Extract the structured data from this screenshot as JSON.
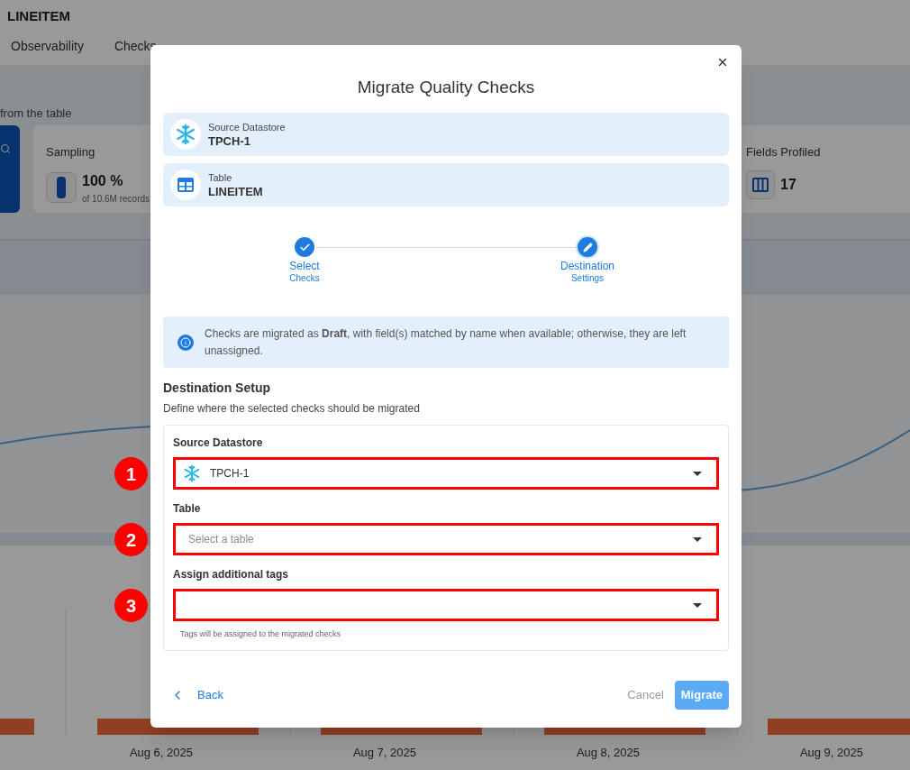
{
  "page": {
    "title": "LINEITEM",
    "tabs": [
      {
        "label": "Observability",
        "selected": false
      },
      {
        "label": "Checks",
        "selected": false
      }
    ],
    "subtitle": "from the table",
    "stats": [
      {
        "label": "Sampling",
        "value": "100 %",
        "note": "of 10.6M records",
        "kind": "sampling"
      },
      {
        "label": "Fields Profiled",
        "value": "17",
        "kind": "fields"
      }
    ],
    "chart_dates": [
      "Aug 6, 2025",
      "Aug 7, 2025",
      "Aug 8, 2025",
      "Aug 9, 2025"
    ]
  },
  "dialog": {
    "title": "Migrate Quality Checks",
    "summary": [
      {
        "label": "Source Datastore",
        "value": "TPCH-1",
        "kind": "datastore"
      },
      {
        "label": "Table",
        "value": "LINEITEM",
        "kind": "table"
      }
    ],
    "steps": [
      {
        "title": "Select",
        "subtitle": "Checks",
        "completed": true
      },
      {
        "title": "Destination",
        "subtitle": "Settings",
        "completed": false
      }
    ],
    "notice": "Checks are migrated as **Draft**, with field(s) matched by name when available; otherwise, they are left unassigned.",
    "section_title": "Destination Setup",
    "section_description": "Define where the selected checks should be migrated",
    "fields": [
      {
        "label": "Source Datastore",
        "value": "TPCH-1",
        "kind": "datastore",
        "highlighted": true,
        "marker": "1"
      },
      {
        "label": "Table",
        "placeholder": "Select a table",
        "kind": "plain",
        "highlighted": true,
        "marker": "2"
      },
      {
        "label": "Assign additional tags",
        "kind": "plain",
        "highlighted": true,
        "marker": "3",
        "helper": "Tags will be assigned to the migrated checks"
      }
    ],
    "back": "Back",
    "cancel": "Cancel",
    "submit": {
      "label": "Migrate",
      "disabled": true
    }
  }
}
